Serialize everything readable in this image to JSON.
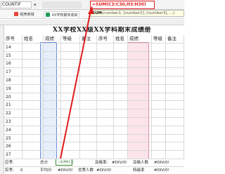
{
  "formula_bar": {
    "name_box": "COUNTIF",
    "formula": "=SUM(C3:C30,H3:H30)"
  },
  "tabs": {
    "first": "稻壳商城",
    "second": "XX学校期末成绩"
  },
  "tooltip": {
    "fn": "SUM",
    "args": "(number1, [number2], [number3], ...)"
  },
  "sheet": {
    "title": "XX学校XX级XX学科期末成绩册",
    "headers": [
      "序号",
      "姓名",
      "成绩",
      "等级",
      "备注",
      "序号",
      "姓名",
      "成绩",
      "等级",
      "备注"
    ],
    "row_numbers": [
      "14",
      "15",
      "16",
      "17",
      "18",
      "19",
      "20",
      "21",
      "22",
      "23",
      "24",
      "25",
      "26",
      "27"
    ]
  },
  "footer": {
    "row1": [
      "应考:",
      "",
      "总分",
      "=SUM(C3:C",
      "及格率:",
      "#DIV/0!",
      "及格人数",
      "#DIV/0!"
    ],
    "row2": [
      "实考:",
      "0",
      "平均分",
      "#DIV/0!",
      "优秀人数",
      "#DIV/0!",
      "特级率",
      "#DIV/0!"
    ]
  },
  "colors": {
    "highlight_blue": "#e6eefa",
    "highlight_pink": "#fbe4ea",
    "annotation_red": "#e21b1b"
  }
}
